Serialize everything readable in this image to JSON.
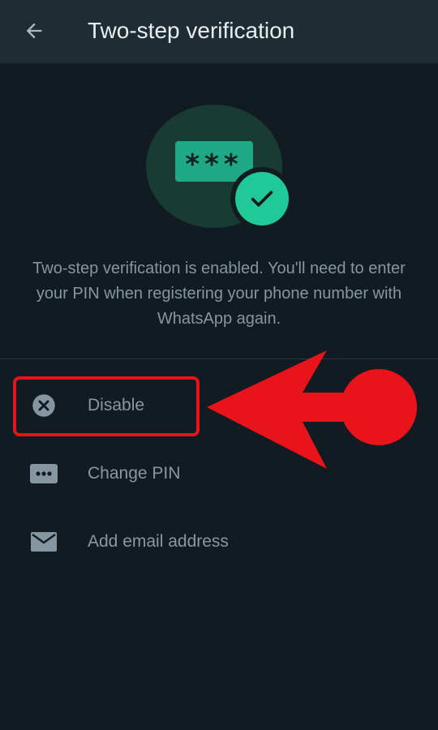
{
  "app_bar": {
    "title": "Two-step verification",
    "back_icon": "arrow-left-icon"
  },
  "hero": {
    "pin_mask": "***",
    "description": "Two-step verification is enabled. You'll need to enter your PIN when registering your phone number with WhatsApp again."
  },
  "options": [
    {
      "label": "Disable",
      "icon": "close-circle-icon"
    },
    {
      "label": "Change PIN",
      "icon": "dots-keyboard-icon"
    },
    {
      "label": "Add email address",
      "icon": "mail-icon"
    }
  ],
  "annotation": {
    "color": "#e8131b"
  },
  "colors": {
    "background": "#121b22",
    "app_bar": "#1f2c34",
    "accent": "#20c997",
    "text_primary": "#e9edef",
    "text_secondary": "#8696a0"
  }
}
